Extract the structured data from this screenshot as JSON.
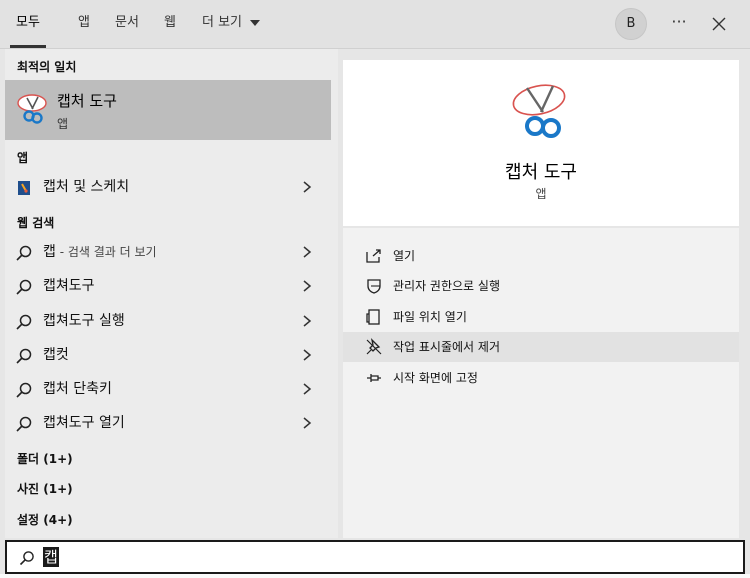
{
  "tabs": [
    {
      "label": "모두"
    },
    {
      "label": "앱"
    },
    {
      "label": "문서"
    },
    {
      "label": "웹"
    },
    {
      "label": "더 보기"
    }
  ],
  "header": {
    "avatar_letter": "B",
    "more_label": "···"
  },
  "left": {
    "best_match_label": "최적의 일치",
    "best_match": {
      "title": "캡처 도구",
      "subtitle": "앱"
    },
    "apps_label": "앱",
    "apps": [
      {
        "label": "캡처 및 스케치"
      }
    ],
    "web_label": "웹 검색",
    "web_items": [
      {
        "label": "캡",
        "sub": " - 검색 결과 더 보기"
      },
      {
        "label": "캡쳐도구",
        "sub": ""
      },
      {
        "label": "캡쳐도구 실행",
        "sub": ""
      },
      {
        "label": "캡컷",
        "sub": ""
      },
      {
        "label": "캡처 단축키",
        "sub": ""
      },
      {
        "label": "캡쳐도구 열기",
        "sub": ""
      }
    ],
    "folders_label": "폴더 (1+)",
    "photos_label": "사진 (1+)",
    "settings_label": "설정 (4+)"
  },
  "detail": {
    "title": "캡처 도구",
    "subtitle": "앱",
    "actions": [
      {
        "label": "열기",
        "icon": "open-icon"
      },
      {
        "label": "관리자 권한으로 실행",
        "icon": "shield-icon"
      },
      {
        "label": "파일 위치 열기",
        "icon": "file-location-icon"
      },
      {
        "label": "작업 표시줄에서 제거",
        "icon": "unpin-icon"
      },
      {
        "label": "시작 화면에 고정",
        "icon": "pin-icon"
      }
    ]
  },
  "search": {
    "value": "캡"
  },
  "colors": {
    "highlight": "#bdbdbd",
    "panel": "#ececec",
    "snip_blue": "#1a78c8",
    "snip_red": "#d9534f"
  }
}
